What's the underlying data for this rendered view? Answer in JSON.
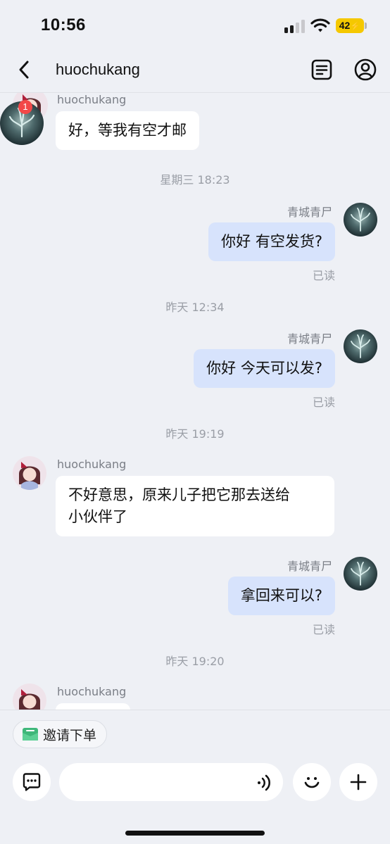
{
  "status_bar": {
    "time": "10:56",
    "battery": "42"
  },
  "header": {
    "title": "huochukang"
  },
  "chat": {
    "messages": [
      {
        "sender": "huochukang",
        "text": "好，等我有空才邮",
        "badge": "1"
      },
      {
        "time": "星期三 18:23"
      },
      {
        "sender": "青城青尸",
        "text": "你好 有空发货?",
        "status": "已读"
      },
      {
        "time": "昨天 12:34"
      },
      {
        "sender": "青城青尸",
        "text": "你好 今天可以发?",
        "status": "已读"
      },
      {
        "time": "昨天 19:19"
      },
      {
        "sender": "huochukang",
        "text_line1": "不好意思，原来儿子把它那去送给",
        "text_line2": "小伙伴了"
      },
      {
        "sender": "青城青尸",
        "text": "拿回来可以?",
        "status": "已读"
      },
      {
        "time": "昨天 19:20"
      },
      {
        "sender": "huochukang"
      }
    ]
  },
  "quick_actions": {
    "invite_order": "邀请下单"
  },
  "input": {
    "placeholder": ""
  },
  "colors": {
    "outgoing_bubble": "#d7e3fc",
    "incoming_bubble": "#ffffff",
    "background": "#eef0f5",
    "badge": "#f24848",
    "battery": "#f5c800"
  },
  "icons": [
    "back-icon",
    "order-list-icon",
    "profile-icon",
    "chat-bubble-icon",
    "voice-icon",
    "emoji-icon",
    "plus-icon",
    "envelope-icon"
  ]
}
